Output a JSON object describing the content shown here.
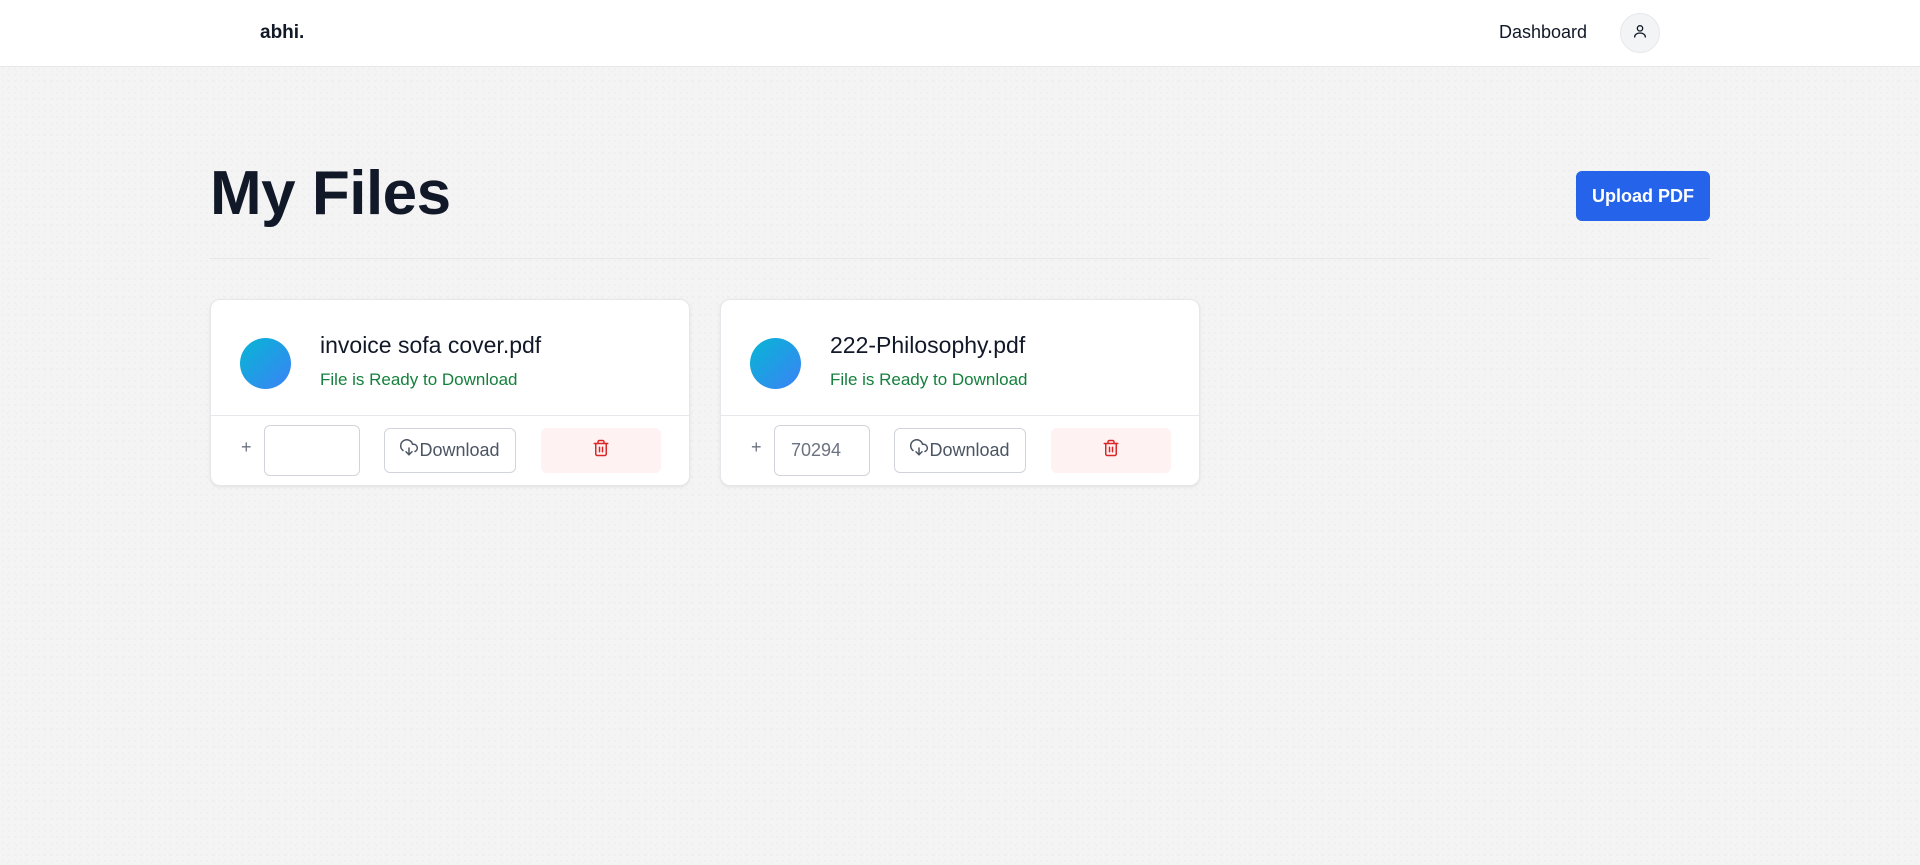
{
  "navbar": {
    "logo": "abhi.",
    "dashboard_label": "Dashboard",
    "avatar_icon": "user-icon"
  },
  "header": {
    "title": "My Files",
    "upload_label": "Upload PDF"
  },
  "files": [
    {
      "name": "invoice sofa cover.pdf",
      "status": "File is Ready to Download",
      "plus": "+",
      "input_value": "",
      "download_label": "Download",
      "download_icon": "cloud-download-icon",
      "delete_icon": "trash-icon"
    },
    {
      "name": "222-Philosophy.pdf",
      "status": "File is Ready to Download",
      "plus": "+",
      "input_value": "70294",
      "download_label": "Download",
      "download_icon": "cloud-download-icon",
      "delete_icon": "trash-icon"
    }
  ],
  "colors": {
    "primary": "#2563eb",
    "status_green": "#15803d",
    "delete_red": "#dc2626",
    "delete_bg": "#fef2f2"
  }
}
